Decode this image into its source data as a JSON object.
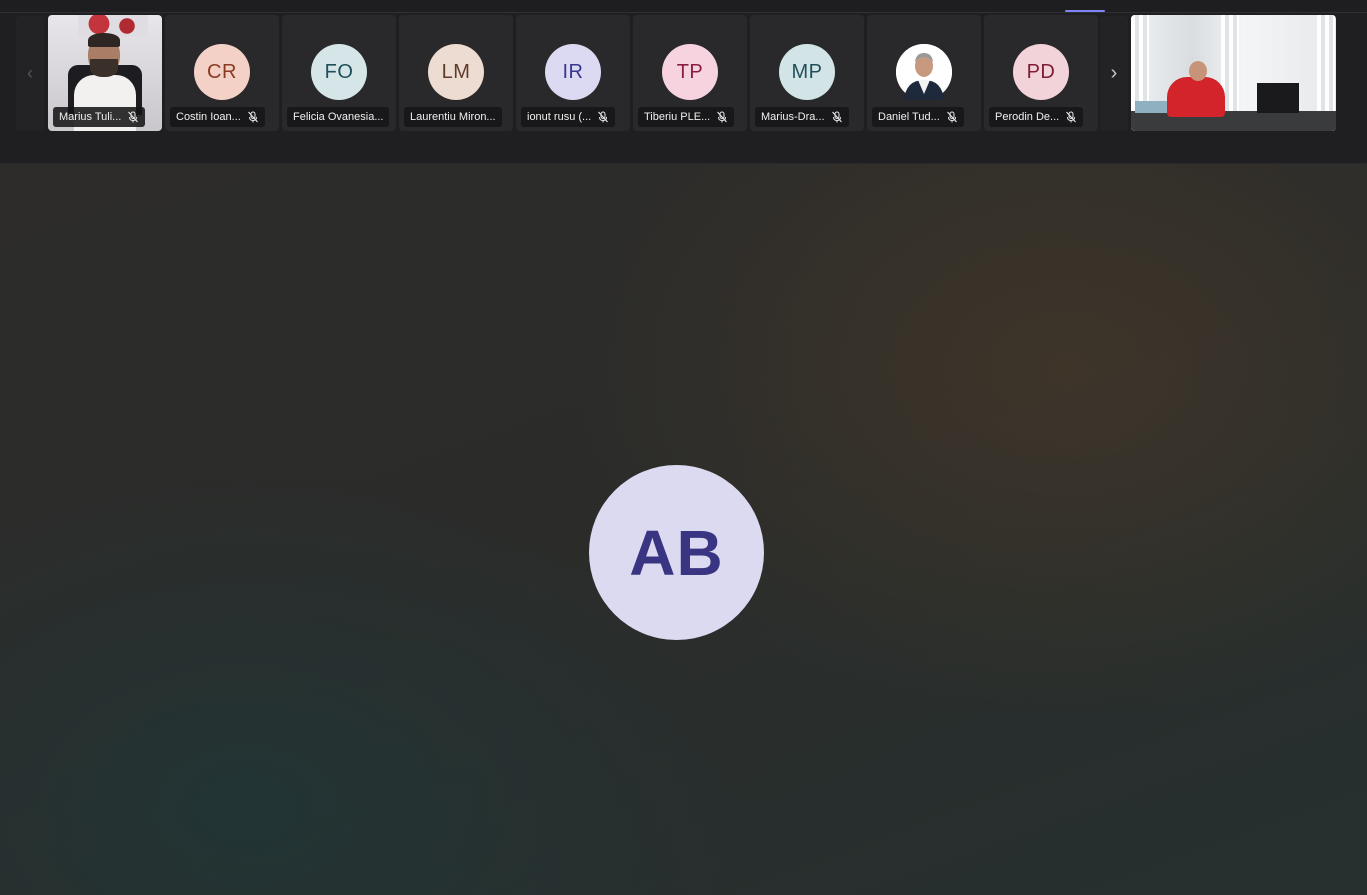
{
  "toolbar": {
    "tabs": [
      {
        "name": "chat-tab",
        "active": true
      },
      {
        "name": "people-tab",
        "active": false
      },
      {
        "name": "raise-tab",
        "active": false
      },
      {
        "name": "react-tab",
        "active": false
      },
      {
        "name": "view-tab",
        "active": false
      },
      {
        "name": "more-tab",
        "active": false
      }
    ]
  },
  "gallery": {
    "prev_icon": "chevron-left-icon",
    "next_icon": "chevron-right-icon",
    "participants": [
      {
        "name": "Marius Tuli...",
        "initials": "",
        "video": true,
        "muted": true
      },
      {
        "name": "Costin Ioan...",
        "initials": "CR",
        "bg": "#f4d1c7",
        "fg": "#8a3b22",
        "muted": true
      },
      {
        "name": "Felicia Ovanesia...",
        "initials": "FO",
        "bg": "#d6e6e8",
        "fg": "#1f4f5a",
        "muted": false
      },
      {
        "name": "Laurentiu Miron...",
        "initials": "LM",
        "bg": "#ecdcd2",
        "fg": "#5e3b2d",
        "muted": false
      },
      {
        "name": "ionut rusu (...",
        "initials": "IR",
        "bg": "#dcdaf2",
        "fg": "#3a3790",
        "muted": true
      },
      {
        "name": "Tiberiu PLE...",
        "initials": "TP",
        "bg": "#f6d3de",
        "fg": "#8c1d44",
        "muted": true
      },
      {
        "name": "Marius-Dra...",
        "initials": "MP",
        "bg": "#d3e4e6",
        "fg": "#1f4f5a",
        "muted": true
      },
      {
        "name": "Daniel Tud...",
        "initials": "",
        "photo": true,
        "muted": true
      },
      {
        "name": "Perodin De...",
        "initials": "PD",
        "bg": "#f2d3d9",
        "fg": "#7e1d30",
        "muted": true
      }
    ]
  },
  "stage": {
    "initials": "AB",
    "bg": "#dcdaf0",
    "fg": "#3a3582"
  },
  "colors": {
    "accent": "#7f85f5",
    "panel": "#1f1f21",
    "tile": "#29292c"
  }
}
